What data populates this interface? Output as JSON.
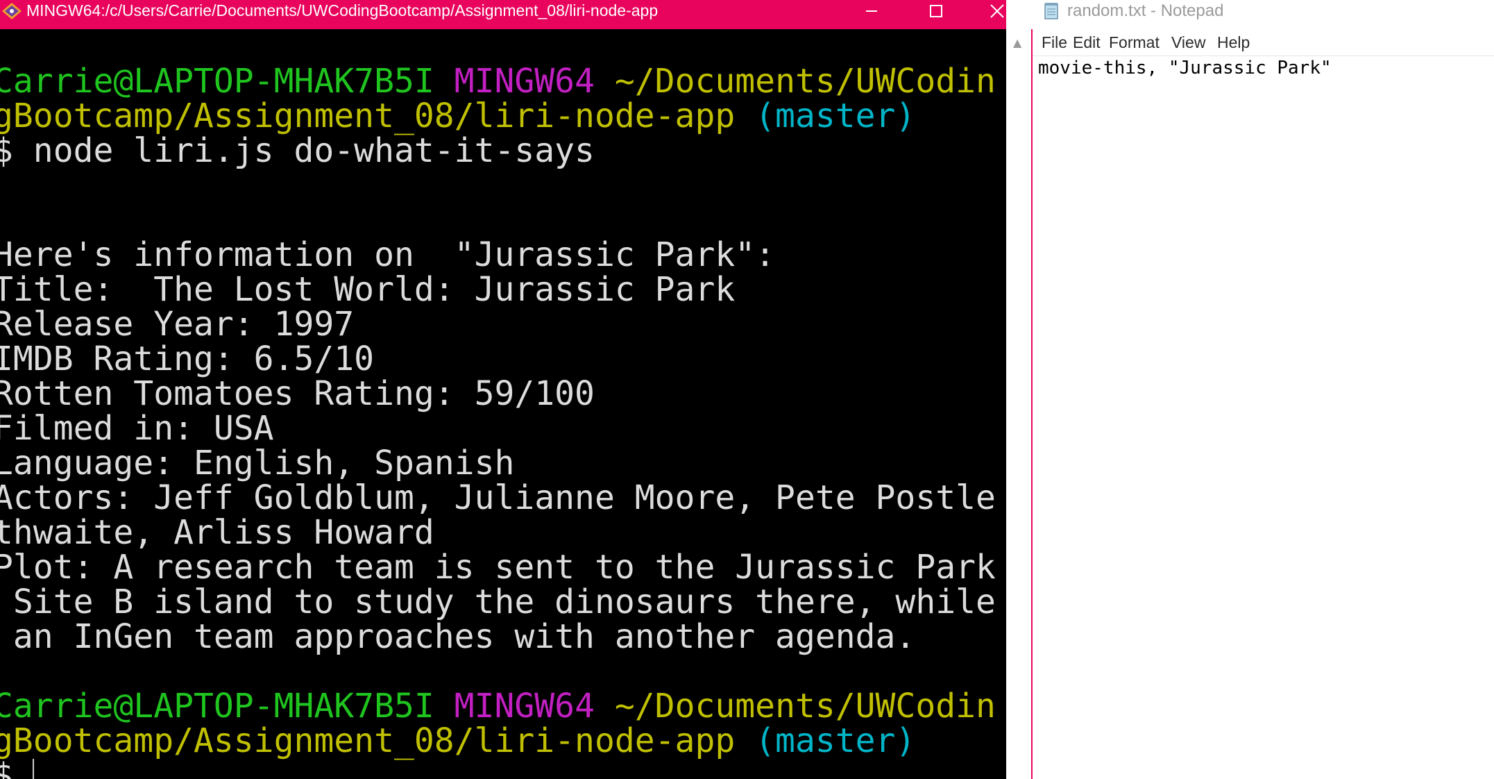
{
  "terminal": {
    "title": "MINGW64:/c/Users/Carrie/Documents/UWCodingBootcamp/Assignment_08/liri-node-app",
    "prompt": {
      "user_host": "Carrie@LAPTOP-MHAK7B5I",
      "shell": "MINGW64",
      "path_line1": "~/Documents/UWCodin",
      "path_line2": "gBootcamp/Assignment_08/liri-node-app",
      "branch": "(master)",
      "symbol": "$"
    },
    "command": "$ node liri.js do-what-it-says",
    "output": [
      "Here's information on  \"Jurassic Park\":",
      "Title:  The Lost World: Jurassic Park",
      "Release Year: 1997",
      "IMDB Rating: 6.5/10",
      "Rotten Tomatoes Rating: 59/100",
      "Filmed in: USA",
      "Language: English, Spanish",
      "Actors: Jeff Goldblum, Julianne Moore, Pete Postle",
      "thwaite, Arliss Howard",
      "Plot: A research team is sent to the Jurassic Park",
      " Site B island to study the dinosaurs there, while",
      " an InGen team approaches with another agenda."
    ],
    "colors": {
      "titlebar": "#e8045c",
      "background": "#000000",
      "user_host": "#1fc41f",
      "shell": "#c220c2",
      "path": "#c0c000",
      "branch": "#00b5c8",
      "text": "#dcdcdc"
    },
    "window_buttons": [
      "minimize-icon",
      "maximize-icon",
      "close-icon"
    ]
  },
  "notepad": {
    "title": "random.txt - Notepad",
    "menu": [
      "File",
      "Edit",
      "Format",
      "View",
      "Help"
    ],
    "content": "movie-this, \"Jurassic Park\""
  }
}
